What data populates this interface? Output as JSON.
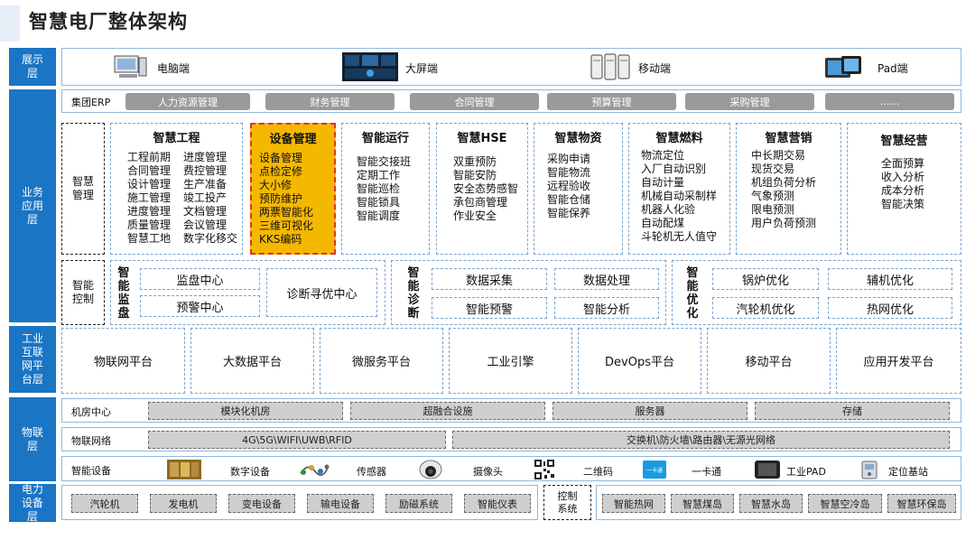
{
  "title": "智慧电厂整体架构",
  "layers": {
    "display": "展示层",
    "business": "业务应用层",
    "platform": "工业互联网平台层",
    "iot": "物联层",
    "power": "电力设备层"
  },
  "display_items": [
    {
      "label": "电脑端",
      "icon": "computer-icon"
    },
    {
      "label": "大屏端",
      "icon": "big-screen-icon"
    },
    {
      "label": "移动端",
      "icon": "mobile-icon"
    },
    {
      "label": "Pad端",
      "icon": "tablet-icon"
    }
  ],
  "erp": {
    "label": "集团ERP",
    "items": [
      "人力资源管理",
      "财务管理",
      "合同管理",
      "预算管理",
      "采购管理",
      "……"
    ]
  },
  "smart_management": {
    "label": "智慧管理",
    "columns": [
      {
        "title": "智慧工程",
        "items_left": [
          "工程前期",
          "合同管理",
          "设计管理",
          "施工管理",
          "进度管理",
          "质量管理",
          "智慧工地"
        ],
        "items_right": [
          "进度管理",
          "费控管理",
          "生产准备",
          "竣工投产",
          "文档管理",
          "会议管理",
          "数字化移交"
        ]
      },
      {
        "title": "设备管理",
        "items": [
          "设备管理",
          "点检定修",
          "大小修",
          "预防维护",
          "两票智能化",
          "三维可视化",
          "KKS编码"
        ]
      },
      {
        "title": "智能运行",
        "items": [
          "智能交接班",
          "定期工作",
          "智能巡检",
          "智能锁具",
          "智能调度"
        ]
      },
      {
        "title": "智慧HSE",
        "items": [
          "双重预防",
          "智能安防",
          "安全态势感智",
          "承包商管理",
          "作业安全"
        ]
      },
      {
        "title": "智慧物资",
        "items": [
          "采购申请",
          "智能物流",
          "远程验收",
          "智能仓储",
          "智能保养"
        ]
      },
      {
        "title": "智慧燃料",
        "items": [
          "物流定位",
          "入厂自动识别",
          "自动计量",
          "机械自动采制样",
          "机器人化验",
          "自动配煤",
          "斗轮机无人值守"
        ]
      },
      {
        "title": "智慧营销",
        "items": [
          "中长期交易",
          "现货交易",
          "机组负荷分析",
          "气象预测",
          "限电预测",
          "用户负荷预测"
        ]
      },
      {
        "title": "智慧经营",
        "items": [
          "全面预算",
          "收入分析",
          "成本分析",
          "智能决策"
        ]
      }
    ]
  },
  "smart_control": {
    "label": "智能控制",
    "monitor": {
      "title": "智能监盘",
      "items": [
        "监盘中心",
        "预警中心",
        "诊断寻优中心"
      ]
    },
    "diagnose": {
      "title": "智能诊断",
      "items": [
        "数据采集",
        "数据处理",
        "智能预警",
        "智能分析"
      ]
    },
    "optimize": {
      "title": "智能优化",
      "items": [
        "锅炉优化",
        "辅机优化",
        "汽轮机优化",
        "热网优化"
      ]
    }
  },
  "platform_items": [
    "物联网平台",
    "大数据平台",
    "微服务平台",
    "工业引擎",
    "DevOps平台",
    "移动平台",
    "应用开发平台"
  ],
  "iot": {
    "room": {
      "label": "机房中心",
      "items": [
        "模块化机房",
        "超融合设施",
        "服务器",
        "存储"
      ]
    },
    "network": {
      "label": "物联网络",
      "items": [
        "4G\\5G\\WIFI\\UWB\\RFID",
        "交换机\\防火墙\\路由器\\无源光网络"
      ]
    },
    "devices": {
      "label": "智能设备",
      "items": [
        {
          "label": "数字设备",
          "icon": "digital-device-icon"
        },
        {
          "label": "传感器",
          "icon": "sensor-icon"
        },
        {
          "label": "摄像头",
          "icon": "camera-icon"
        },
        {
          "label": "二维码",
          "icon": "qrcode-icon"
        },
        {
          "label": "一卡通",
          "icon": "card-icon",
          "icon_text": "一卡通"
        },
        {
          "label": "工业PAD",
          "icon": "industrial-pad-icon"
        },
        {
          "label": "定位基站",
          "icon": "base-station-icon"
        }
      ]
    }
  },
  "power": {
    "items": [
      "汽轮机",
      "发电机",
      "变电设备",
      "输电设备",
      "励磁系统",
      "智能仪表"
    ],
    "control_label": "控制系统",
    "control_items": [
      "智能热网",
      "智慧煤岛",
      "智慧水岛",
      "智慧空冷岛",
      "智慧环保岛"
    ]
  },
  "colors": {
    "layer_blue": "#1a75c4",
    "highlight_orange": "#f5b800",
    "highlight_border": "#e0302a",
    "pill_gray": "#9a9a9a"
  }
}
